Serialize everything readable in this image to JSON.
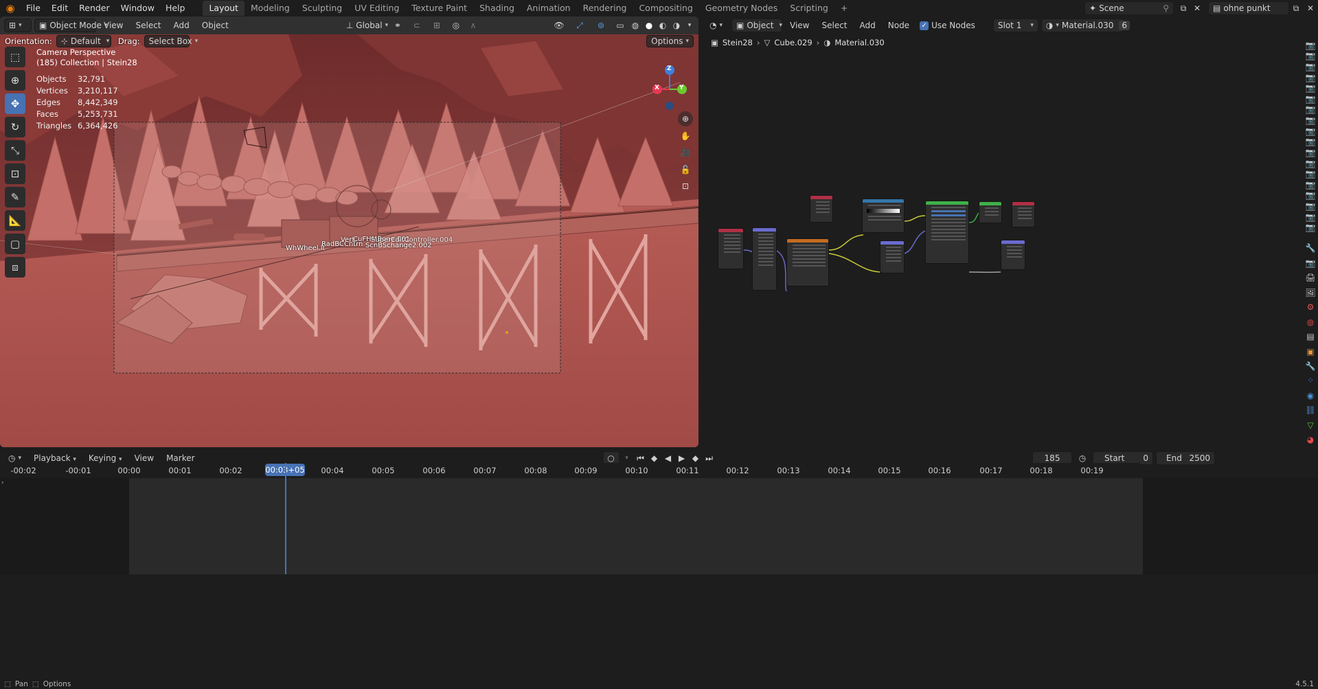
{
  "app": {
    "version": "4.5.1"
  },
  "topbar": {
    "menus": [
      "File",
      "Edit",
      "Render",
      "Window",
      "Help"
    ],
    "workspaces": [
      "Layout",
      "Modeling",
      "Sculpting",
      "UV Editing",
      "Texture Paint",
      "Shading",
      "Animation",
      "Rendering",
      "Compositing",
      "Geometry Nodes",
      "Scripting"
    ],
    "active_workspace": "Layout",
    "add_workspace": "+",
    "scene": "Scene",
    "view_layer": "ohne punkt"
  },
  "viewport": {
    "mode": "Object Mode",
    "menus": [
      "View",
      "Select",
      "Add",
      "Object"
    ],
    "transform_orientation": "Global",
    "orientation_label": "Orientation:",
    "orientation_value": "Default",
    "drag_label": "Drag:",
    "drag_value": "Select Box",
    "options": "Options",
    "overlay_title": "Camera Perspective",
    "overlay_collection": "(185) Collection | Stein28",
    "stats": [
      {
        "label": "Objects",
        "value": "32,791"
      },
      {
        "label": "Vertices",
        "value": "3,210,117"
      },
      {
        "label": "Edges",
        "value": "8,442,349"
      },
      {
        "label": "Faces",
        "value": "5,253,731"
      },
      {
        "label": "Triangles",
        "value": "6,364,426"
      }
    ],
    "scene_labels": [
      "WhWheel.lt",
      "RadBCCntrn",
      "Vert",
      "CuFHMBone.001",
      "Bone",
      "ScnBSchange2.002",
      "SuperEditController.004"
    ],
    "gizmo": {
      "z": "Z",
      "y": "Y",
      "x": "X"
    },
    "colors": {
      "sky": "#7a3030",
      "scene_tint": "#b55f59",
      "ground": "#a9514c",
      "selection": "#c38f89"
    }
  },
  "node_editor": {
    "type": "Object",
    "menus": [
      "View",
      "Select",
      "Add",
      "Node"
    ],
    "use_nodes_label": "Use Nodes",
    "slot": "Slot 1",
    "material": "Material.030",
    "material_users": "6",
    "breadcrumb": [
      "Stein28",
      "Cube.029",
      "Material.030"
    ]
  },
  "timeline": {
    "menus": [
      "Playback",
      "Keying",
      "View",
      "Marker"
    ],
    "current_frame": "185",
    "start_label": "Start",
    "start": "0",
    "end_label": "End",
    "end": "2500",
    "current_time": "00:03+05",
    "ticks": [
      "-00:02",
      "-00:01",
      "00:00",
      "00:01",
      "00:02",
      "00:03+05",
      "00:04",
      "00:05",
      "00:06",
      "00:07",
      "00:08",
      "00:09",
      "00:10",
      "00:11",
      "00:12",
      "00:13",
      "00:14",
      "00:15",
      "00:16",
      "00:17",
      "00:18",
      "00:19"
    ]
  },
  "statusbar": {
    "pan": "Pan",
    "options": "Options",
    "version": "4.5.1"
  }
}
